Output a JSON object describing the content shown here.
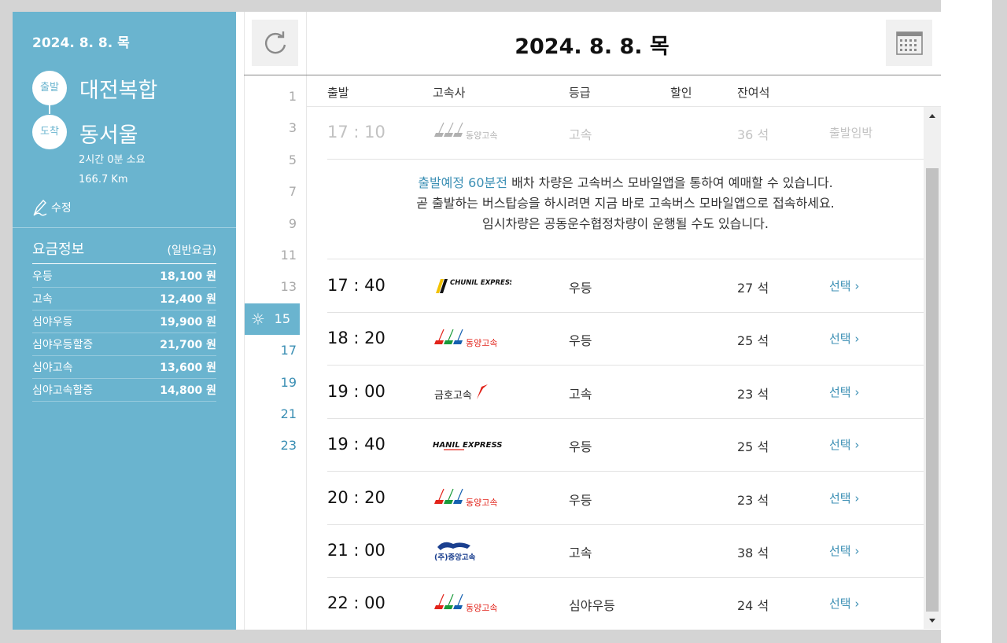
{
  "sidebar": {
    "date": "2024. 8. 8. 목",
    "departure_label": "출발",
    "departure_name": "대전복합",
    "arrival_label": "도착",
    "arrival_name": "동서울",
    "duration": "2시간 0분 소요",
    "distance": "166.7 Km",
    "edit_label": "수정",
    "fare_title": "요금정보",
    "fare_note": "(일반요금)",
    "fares": [
      {
        "name": "우등",
        "price": "18,100 원"
      },
      {
        "name": "고속",
        "price": "12,400 원"
      },
      {
        "name": "심야우등",
        "price": "19,900 원"
      },
      {
        "name": "심야우등할증",
        "price": "21,700 원"
      },
      {
        "name": "심야고속",
        "price": "13,600 원"
      },
      {
        "name": "심야고속할증",
        "price": "14,800 원"
      }
    ]
  },
  "header": {
    "title": "2024. 8. 8. 목",
    "refresh_icon": "refresh-icon",
    "calendar_icon": "calendar-icon"
  },
  "hours": [
    "1",
    "3",
    "5",
    "7",
    "9",
    "11",
    "13",
    "15",
    "17",
    "19",
    "21",
    "23"
  ],
  "active_hour": "15",
  "columns": {
    "departure": "출발",
    "company": "고속사",
    "grade": "등급",
    "discount": "할인",
    "seats": "잔여석"
  },
  "departed_row": {
    "time": "17 : 10",
    "company": "동양고속",
    "grade": "고속",
    "seats": "36 석",
    "status": "출발임박"
  },
  "notice": {
    "highlight": "출발예정 60분전",
    "line1_rest": " 배차 차량은 고속버스 모바일앱을 통하여 예매할 수 있습니다.",
    "line2": "곧 출발하는 버스탑승을 하시려면 지금 바로 고속버스 모바일앱으로 접속하세요.",
    "line3": "임시차량은 공동운수협정차량이 운행될 수도 있습니다."
  },
  "rows": [
    {
      "time": "17 : 40",
      "company": "CHUNIL EXPRESS",
      "logo": "chunil",
      "grade": "우등",
      "seats": "27 석",
      "select": "선택"
    },
    {
      "time": "18 : 20",
      "company": "동양고속",
      "logo": "dongyang",
      "grade": "우등",
      "seats": "25 석",
      "select": "선택"
    },
    {
      "time": "19 : 00",
      "company": "금호고속",
      "logo": "kumho",
      "grade": "고속",
      "seats": "23 석",
      "select": "선택"
    },
    {
      "time": "19 : 40",
      "company": "HANIL EXPRESS",
      "logo": "hanil",
      "grade": "우등",
      "seats": "25 석",
      "select": "선택"
    },
    {
      "time": "20 : 20",
      "company": "동양고속",
      "logo": "dongyang",
      "grade": "우등",
      "seats": "23 석",
      "select": "선택"
    },
    {
      "time": "21 : 00",
      "company": "(주)중앙고속",
      "logo": "jungang",
      "grade": "고속",
      "seats": "38 석",
      "select": "선택"
    },
    {
      "time": "22 : 00",
      "company": "동양고속",
      "logo": "dongyang",
      "grade": "심야우등",
      "seats": "24 석",
      "select": "선택"
    }
  ],
  "colors": {
    "sidebar_bg": "#6ab4cf",
    "accent_link": "#3b8fb4"
  }
}
